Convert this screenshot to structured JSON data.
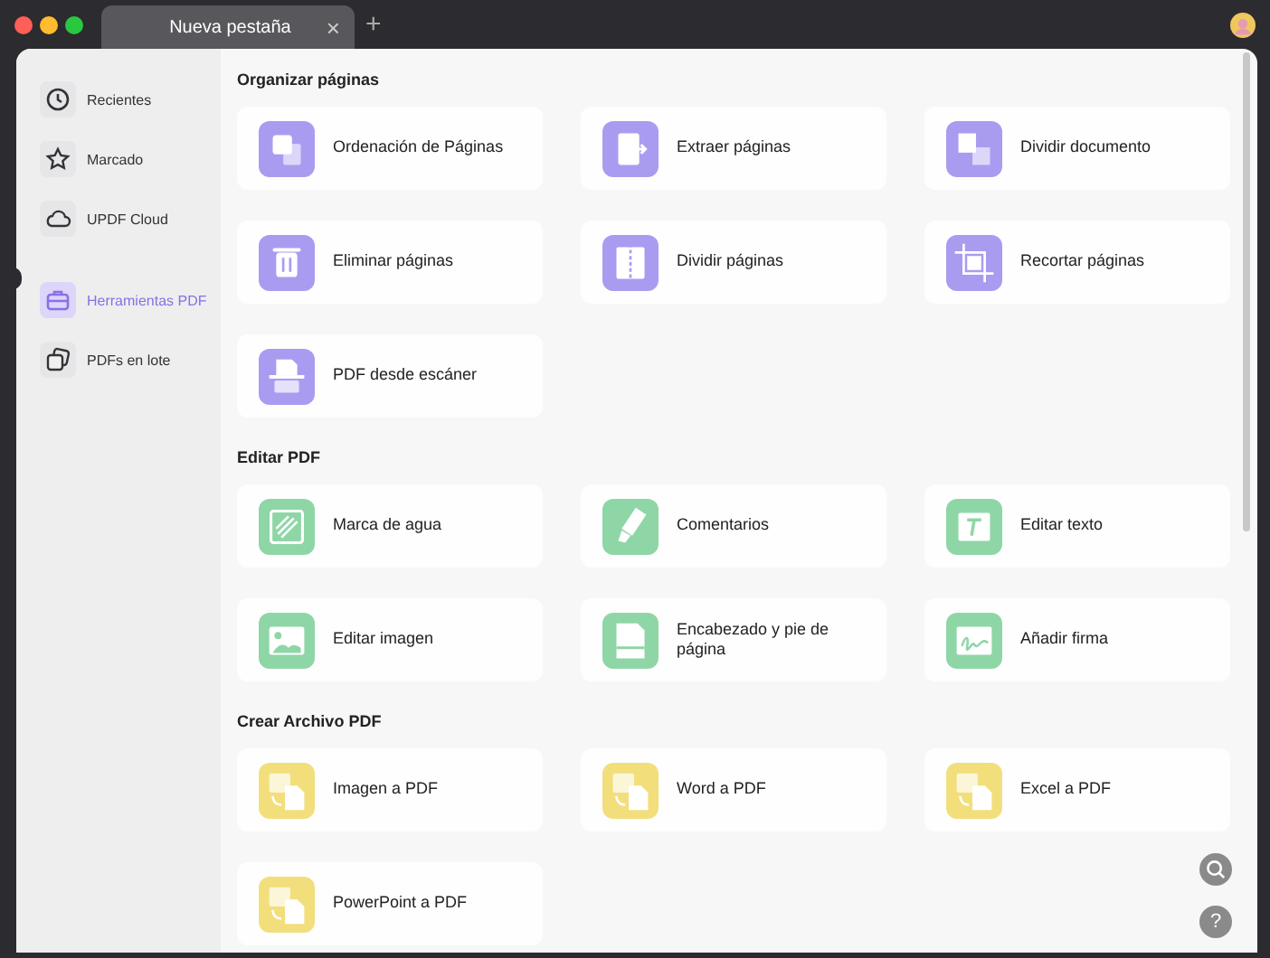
{
  "tabs": [
    {
      "label": "Nueva pestaña",
      "selected": true,
      "close": "×"
    }
  ],
  "new_tab": "+",
  "sidebar": {
    "items": [
      {
        "label": "Recientes",
        "kind": "clock",
        "selected": false
      },
      {
        "label": "Marcado",
        "kind": "star",
        "selected": false
      },
      {
        "label": "UPDF Cloud",
        "kind": "cloud",
        "selected": false
      },
      {
        "label": "Herramientas PDF",
        "kind": "briefcase",
        "selected": true
      },
      {
        "label": "PDFs en lote",
        "kind": "copies",
        "selected": false
      }
    ]
  },
  "sections": [
    {
      "title": "Organizar páginas",
      "color": "#a99cf0",
      "tools": [
        {
          "label": "Ordenación de Páginas",
          "kind": "pages"
        },
        {
          "label": "Extraer páginas",
          "kind": "extract"
        },
        {
          "label": "Dividir documento",
          "kind": "split"
        },
        {
          "label": "Eliminar páginas",
          "kind": "trash"
        },
        {
          "label": "Dividir páginas",
          "kind": "columns"
        },
        {
          "label": "Recortar páginas",
          "kind": "crop"
        },
        {
          "label": "PDF desde escáner",
          "kind": "scanner"
        }
      ]
    },
    {
      "title": "Editar PDF",
      "color": "#8fd6a7",
      "tools": [
        {
          "label": "Marca de agua",
          "kind": "watermark"
        },
        {
          "label": "Comentarios",
          "kind": "marker"
        },
        {
          "label": "Editar texto",
          "kind": "text"
        },
        {
          "label": "Editar imagen",
          "kind": "image"
        },
        {
          "label": "Encabezado y pie de página",
          "kind": "document"
        },
        {
          "label": "Añadir firma",
          "kind": "signature"
        }
      ]
    },
    {
      "title": "Crear Archivo PDF",
      "color": "#f2df7c",
      "tools": [
        {
          "label": "Imagen a PDF",
          "kind": "convert"
        },
        {
          "label": "Word a PDF",
          "kind": "convert"
        },
        {
          "label": "Excel a PDF",
          "kind": "convert"
        },
        {
          "label": "PowerPoint a PDF",
          "kind": "convert"
        }
      ]
    }
  ],
  "help_button": "?"
}
